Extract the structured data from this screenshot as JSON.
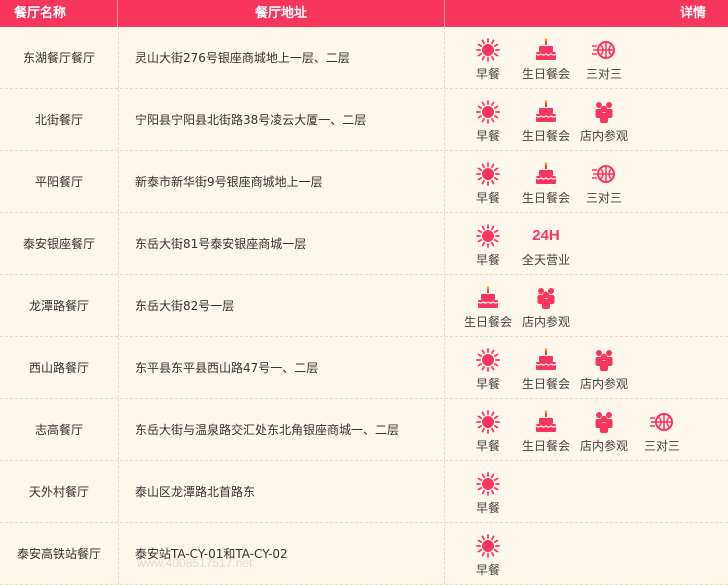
{
  "header": {
    "name": "餐厅名称",
    "address": "餐厅地址",
    "details": "详情"
  },
  "colors": {
    "accent": "#f8365d",
    "background": "#fdf7ec"
  },
  "feature_labels": {
    "breakfast": "早餐",
    "birthday": "生日餐会",
    "basketball": "三对三",
    "visit": "店内参观",
    "allday_top": "24H",
    "allday": "全天营业"
  },
  "rows": [
    {
      "name": "东湖餐厅餐厅",
      "address": "灵山大街276号银座商城地上一层、二层",
      "features": [
        "breakfast",
        "birthday",
        "basketball"
      ]
    },
    {
      "name": "北街餐厅",
      "address": "宁阳县宁阳县北街路38号凌云大厦一、二层",
      "features": [
        "breakfast",
        "birthday",
        "visit"
      ]
    },
    {
      "name": "平阳餐厅",
      "address": "新泰市新华街9号银座商城地上一层",
      "features": [
        "breakfast",
        "birthday",
        "basketball"
      ]
    },
    {
      "name": "泰安银座餐厅",
      "address": "东岳大街81号泰安银座商城一层",
      "features": [
        "breakfast",
        "allday"
      ]
    },
    {
      "name": "龙潭路餐厅",
      "address": "东岳大街82号一层",
      "features": [
        "birthday",
        "visit"
      ]
    },
    {
      "name": "西山路餐厅",
      "address": "东平县东平县西山路47号一、二层",
      "features": [
        "breakfast",
        "birthday",
        "visit"
      ]
    },
    {
      "name": "志高餐厅",
      "address": "东岳大街与温泉路交汇处东北角银座商城一、二层",
      "features": [
        "breakfast",
        "birthday",
        "visit",
        "basketball"
      ]
    },
    {
      "name": "天外村餐厅",
      "address": "泰山区龙潭路北首路东",
      "features": [
        "breakfast"
      ]
    },
    {
      "name": "泰安高铁站餐厅",
      "address": "泰安站TA-CY-01和TA-CY-02",
      "features": [
        "breakfast"
      ]
    }
  ],
  "watermark": "www.4008517517.net"
}
